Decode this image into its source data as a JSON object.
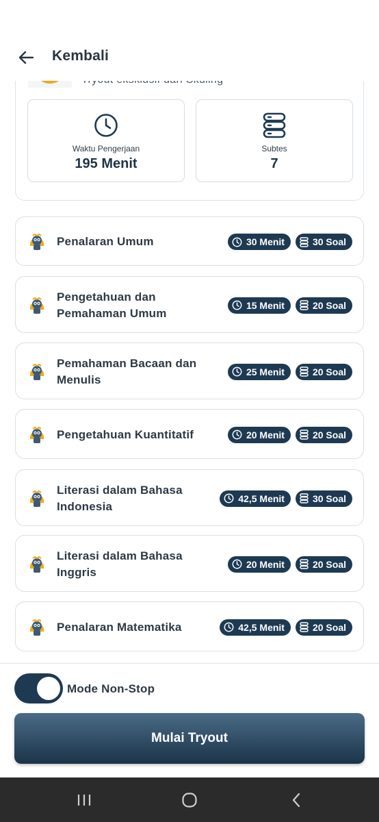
{
  "header": {
    "title": "Kembali"
  },
  "summary": {
    "subtitle": "Tryout eksklusif dari Skuling",
    "duration_label": "Waktu Pengerjaan",
    "duration_value": "195 Menit",
    "subtests_label": "Subtes",
    "subtests_value": "7"
  },
  "subtests": [
    {
      "name": "Penalaran Umum",
      "time": "30 Menit",
      "questions": "30 Soal"
    },
    {
      "name": "Pengetahuan dan Pemahaman Umum",
      "time": "15 Menit",
      "questions": "20 Soal"
    },
    {
      "name": "Pemahaman Bacaan dan Menulis",
      "time": "25 Menit",
      "questions": "20 Soal"
    },
    {
      "name": "Pengetahuan Kuantitatif",
      "time": "20 Menit",
      "questions": "20 Soal"
    },
    {
      "name": "Literasi dalam Bahasa Indonesia",
      "time": "42,5 Menit",
      "questions": "30 Soal"
    },
    {
      "name": "Literasi dalam Bahasa Inggris",
      "time": "20 Menit",
      "questions": "20 Soal"
    },
    {
      "name": "Penalaran Matematika",
      "time": "42,5 Menit",
      "questions": "20 Soal"
    }
  ],
  "footer": {
    "mode_label": "Mode Non-Stop",
    "mode_on": true,
    "start_label": "Mulai Tryout"
  },
  "colors": {
    "primary": "#1e3a52",
    "accent": "#f0a91b"
  },
  "icons": [
    "back-arrow-icon",
    "clock-icon",
    "database-icon",
    "mascot-icon",
    "recent-apps-icon",
    "home-icon",
    "nav-back-icon"
  ]
}
